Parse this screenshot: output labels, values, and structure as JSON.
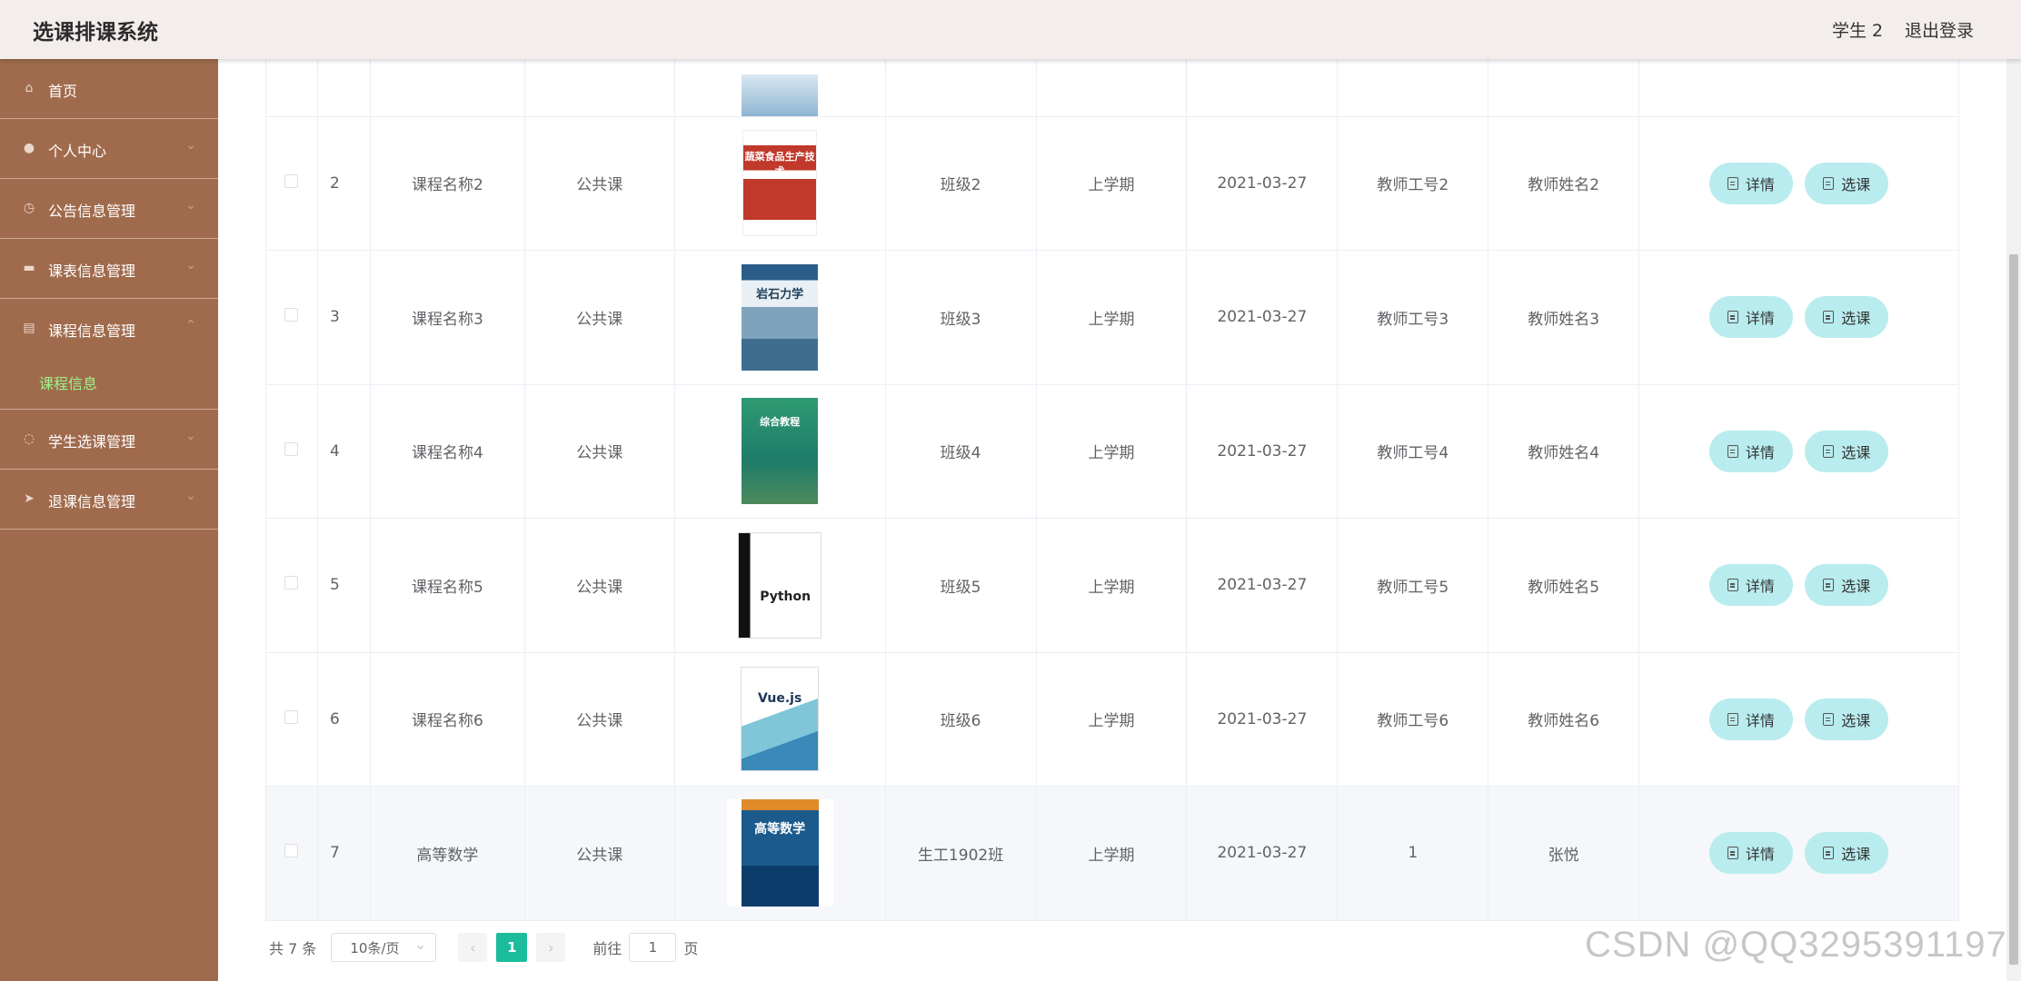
{
  "header": {
    "title": "选课排课系统",
    "user": "学生 2",
    "logout": "退出登录"
  },
  "sidebar": {
    "items": [
      {
        "label": "首页",
        "icon": "home-icon"
      },
      {
        "label": "个人中心",
        "icon": "user-icon"
      },
      {
        "label": "公告信息管理",
        "icon": "clock-icon"
      },
      {
        "label": "课表信息管理",
        "icon": "monitor-icon"
      },
      {
        "label": "课程信息管理",
        "icon": "book-icon"
      },
      {
        "label": "学生选课管理",
        "icon": "circle-icon"
      },
      {
        "label": "退课信息管理",
        "icon": "send-icon"
      }
    ],
    "submenu_active": "课程信息"
  },
  "table": {
    "rows": [
      {
        "index": "2",
        "name": "课程名称2",
        "type": "公共课",
        "class": "班级2",
        "term": "上学期",
        "date": "2021-03-27",
        "teacher_no": "教师工号2",
        "teacher_name": "教师姓名2"
      },
      {
        "index": "3",
        "name": "课程名称3",
        "type": "公共课",
        "class": "班级3",
        "term": "上学期",
        "date": "2021-03-27",
        "teacher_no": "教师工号3",
        "teacher_name": "教师姓名3"
      },
      {
        "index": "4",
        "name": "课程名称4",
        "type": "公共课",
        "class": "班级4",
        "term": "上学期",
        "date": "2021-03-27",
        "teacher_no": "教师工号4",
        "teacher_name": "教师姓名4"
      },
      {
        "index": "5",
        "name": "课程名称5",
        "type": "公共课",
        "class": "班级5",
        "term": "上学期",
        "date": "2021-03-27",
        "teacher_no": "教师工号5",
        "teacher_name": "教师姓名5"
      },
      {
        "index": "6",
        "name": "课程名称6",
        "type": "公共课",
        "class": "班级6",
        "term": "上学期",
        "date": "2021-03-27",
        "teacher_no": "教师工号6",
        "teacher_name": "教师姓名6"
      },
      {
        "index": "7",
        "name": "高等数学",
        "type": "公共课",
        "class": "生工1902班",
        "term": "上学期",
        "date": "2021-03-27",
        "teacher_no": "1",
        "teacher_name": "张悦"
      }
    ],
    "detail_label": "详情",
    "select_label": "选课"
  },
  "covers": {
    "c2": "蔬菜食品生产技术",
    "c3": "岩石力学",
    "c4": "综合教程",
    "c5": "Python",
    "c6": "Vue.js",
    "c7": "高等数学"
  },
  "pagination": {
    "total": "共 7 条",
    "page_size": "10条/页",
    "current": "1",
    "goto_prefix": "前往",
    "goto_value": "1",
    "goto_suffix": "页",
    "prev": "‹",
    "next": "›"
  },
  "watermark": "CSDN @QQ3295391197",
  "colors": {
    "sidebar": "#a06b4d",
    "active_submenu": "#9bf58a",
    "button": "#b9ecee",
    "pager_active": "#1abc9c"
  }
}
